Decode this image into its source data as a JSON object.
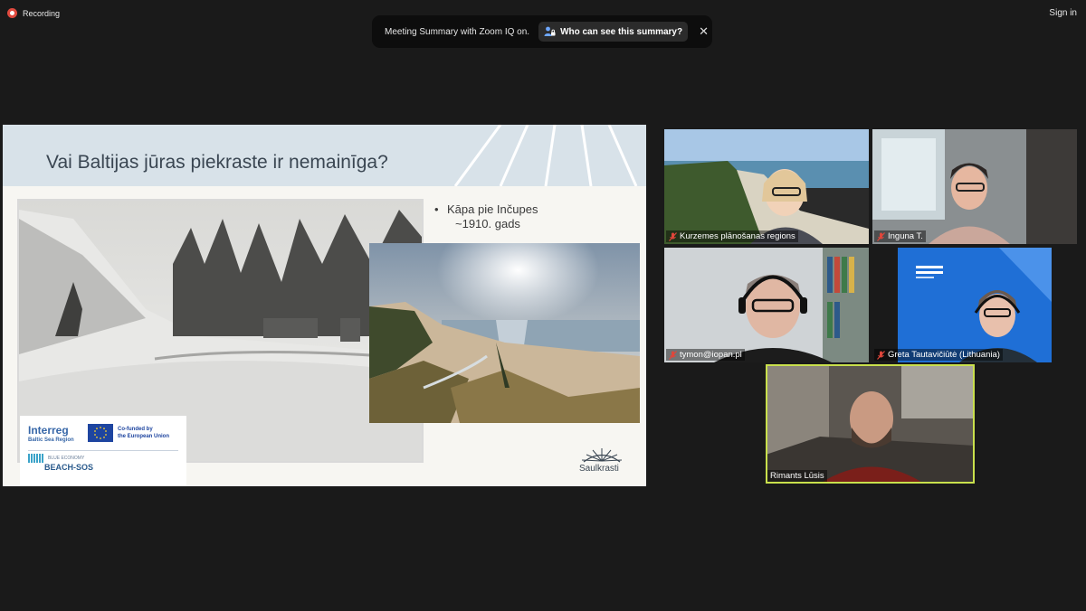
{
  "recording": {
    "label": "Recording"
  },
  "signin": {
    "label": "Sign in"
  },
  "banner": {
    "text": "Meeting Summary with Zoom IQ on.",
    "button_label": "Who can see this summary?",
    "close_icon": "close-icon"
  },
  "slide": {
    "title": "Vai Baltijas jūras piekraste ir nemainīga?",
    "bullet_line1": "Kāpa pie Inčupes",
    "bullet_line2": "~1910. gads",
    "logos": {
      "interreg": "Interreg",
      "interreg_sub": "Baltic Sea Region",
      "eu_line1": "Co-funded by",
      "eu_line2": "the European Union",
      "blue_economy": "BLUE ECONOMY",
      "beach_sos": "BEACH-SOS",
      "saulkrasti": "Saulkrasti"
    }
  },
  "participants": [
    {
      "name": "Kurzemes plānošanas regions",
      "muted": true
    },
    {
      "name": "Inguna T.",
      "muted": true
    },
    {
      "name": "tymon@iopan.pl",
      "muted": true
    },
    {
      "name": "Greta Tautavičiūtė (Lithuania)",
      "muted": true
    },
    {
      "name": "Rimants Lūsis",
      "muted": false,
      "active": true
    }
  ],
  "colors": {
    "active_speaker": "#c9e04c",
    "recording": "#e04a3f",
    "muted_mic": "#e0463b"
  }
}
